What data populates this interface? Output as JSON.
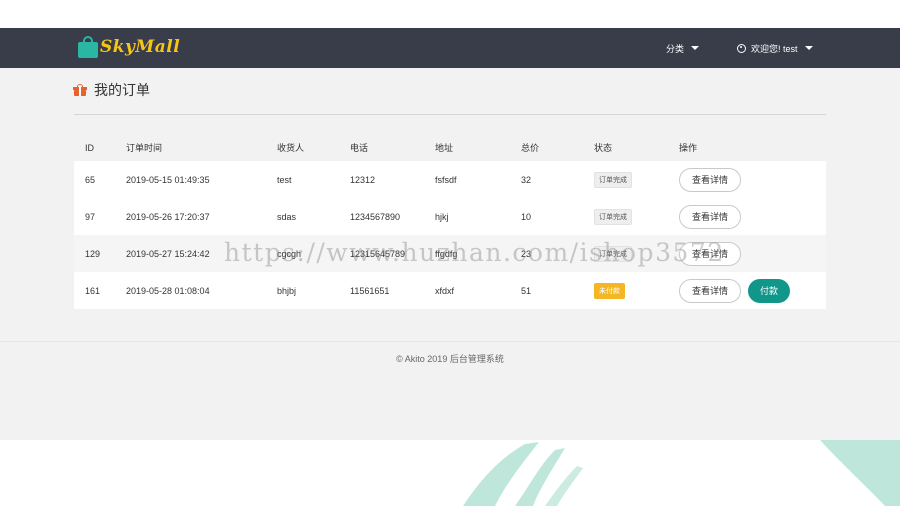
{
  "brand": {
    "name": "SkyMall",
    "logo_icon": "shopping-bag-icon",
    "logo_color": "#f5c518",
    "bag_color": "#2bb6a3"
  },
  "nav": {
    "category_label": "分类",
    "user_greeting": "欢迎您! test"
  },
  "page": {
    "title": "我的订单",
    "title_icon": "gift-icon"
  },
  "table": {
    "headers": [
      "ID",
      "订单时间",
      "收货人",
      "电话",
      "地址",
      "总价",
      "状态",
      "操作"
    ],
    "rows": [
      {
        "id": "65",
        "time": "2019-05-15 01:49:35",
        "name": "test",
        "phone": "12312",
        "address": "fsfsdf",
        "total": "32",
        "status": "订单完成",
        "detail": "查看详情"
      },
      {
        "id": "97",
        "time": "2019-05-26 17:20:37",
        "name": "sdas",
        "phone": "1234567890",
        "address": "hjkj",
        "total": "10",
        "status": "订单完成",
        "detail": "查看详情"
      },
      {
        "id": "129",
        "time": "2019-05-27 15:24:42",
        "name": "cgcgh",
        "phone": "12315645789",
        "address": "ffgdfg",
        "total": "23",
        "status": "订单完成",
        "detail": "查看详情"
      },
      {
        "id": "161",
        "time": "2019-05-28 01:08:04",
        "name": "bhjbj",
        "phone": "11561651",
        "address": "xfdxf",
        "total": "51",
        "status": "未付款",
        "detail": "查看详情",
        "pay": "付款"
      }
    ]
  },
  "footer": {
    "text": "© Akito 2019  后台管理系统"
  },
  "watermark": "https://www.huzhan.com/ishop3572",
  "colors": {
    "navbar": "#393d49",
    "pay_button": "#11968a",
    "unpaid_badge": "#f4b622",
    "accent_brush": "#bfe6da"
  }
}
